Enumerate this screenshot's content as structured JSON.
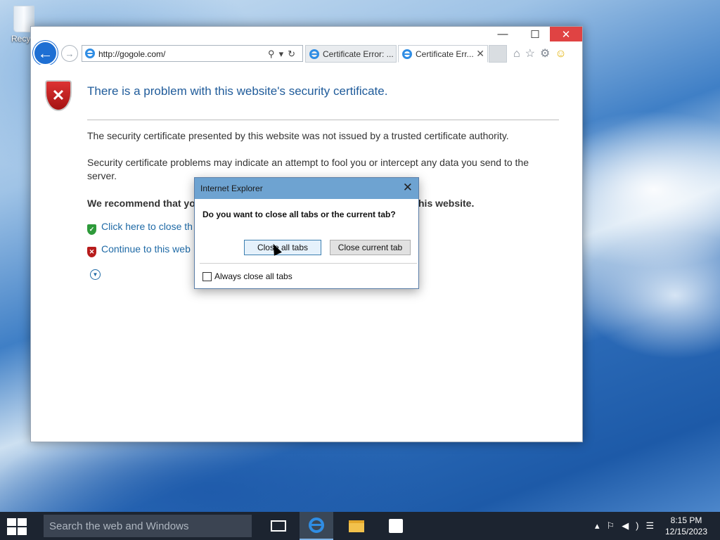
{
  "desktop": {
    "recycle_label": "Recycl"
  },
  "window": {
    "controls": {
      "minimize": "—",
      "maximize": "☐",
      "close": "✕"
    },
    "address": {
      "url": "http://gogole.com/",
      "tools": "⚲▾↻"
    },
    "tabs": [
      {
        "label": "Certificate Error: ..."
      },
      {
        "label": "Certificate Err...",
        "close": "✕"
      }
    ],
    "toolbar_icons": {
      "home": "⌂",
      "favorites": "☆",
      "settings": "⚙",
      "feedback": "☺"
    }
  },
  "page": {
    "headline": "There is a problem with this website's security certificate.",
    "para1": "The security certificate presented by this website was not issued by a trusted certificate authority.",
    "para2": "Security certificate problems may indicate an attempt to fool you or intercept any data you send to the server.",
    "recommend_start": "We recommend that yo",
    "recommend_end": "his website.",
    "link_close": "Click here to close th",
    "link_continue": "Continue to this web"
  },
  "dialog": {
    "title": "Internet Explorer",
    "close": "✕",
    "question": "Do you want to close all tabs or the current tab?",
    "btn_all": "Close all tabs",
    "btn_current": "Close current tab",
    "checkbox_label": "Always close all tabs",
    "checkbox_checked": false
  },
  "taskbar": {
    "search_placeholder": "Search the web and Windows",
    "time": "8:15 PM",
    "date": "12/15/2023",
    "tray_icons": [
      "chevron-up",
      "network",
      "volume",
      "notifications"
    ]
  }
}
